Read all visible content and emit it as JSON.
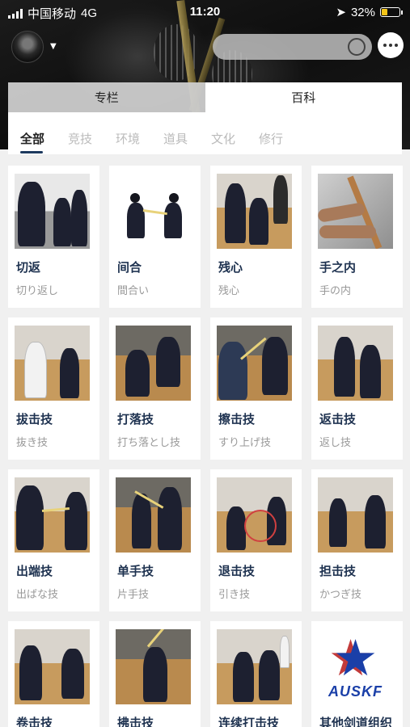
{
  "status_bar": {
    "carrier": "中国移动",
    "network": "4G",
    "time": "11:20",
    "battery": "32%"
  },
  "header": {
    "search": {
      "placeholder": ""
    },
    "icons": {
      "avatar": "user-avatar",
      "chat": "chat-bubble-icon",
      "location": "location-arrow-icon",
      "caret": "chevron-down-icon"
    }
  },
  "top_tabs": [
    {
      "label": "专栏",
      "active": false
    },
    {
      "label": "百科",
      "active": true
    }
  ],
  "categories": [
    {
      "label": "全部",
      "active": true
    },
    {
      "label": "竞技",
      "active": false
    },
    {
      "label": "环境",
      "active": false
    },
    {
      "label": "道具",
      "active": false
    },
    {
      "label": "文化",
      "active": false
    },
    {
      "label": "修行",
      "active": false
    }
  ],
  "cards": [
    {
      "title": "切返",
      "sub": "切り返し"
    },
    {
      "title": "间合",
      "sub": "間合い"
    },
    {
      "title": "残心",
      "sub": "残心"
    },
    {
      "title": "手之内",
      "sub": "手の内"
    },
    {
      "title": "拔击技",
      "sub": "抜き技"
    },
    {
      "title": "打落技",
      "sub": "打ち落とし技"
    },
    {
      "title": "擦击技",
      "sub": "すり上げ技"
    },
    {
      "title": "返击技",
      "sub": "返し技"
    },
    {
      "title": "出端技",
      "sub": "出ばな技"
    },
    {
      "title": "单手技",
      "sub": "片手技"
    },
    {
      "title": "退击技",
      "sub": "引き技"
    },
    {
      "title": "担击技",
      "sub": "かつぎ技"
    },
    {
      "title": "卷击技",
      "sub": ""
    },
    {
      "title": "拂击技",
      "sub": ""
    },
    {
      "title": "连续打击技",
      "sub": ""
    },
    {
      "title": "其他剑道组织",
      "sub": ""
    }
  ],
  "logo_text": "AUSKF",
  "colors": {
    "accent": "#1d3a5f",
    "title": "#1e3250",
    "battery": "#f5c518"
  }
}
